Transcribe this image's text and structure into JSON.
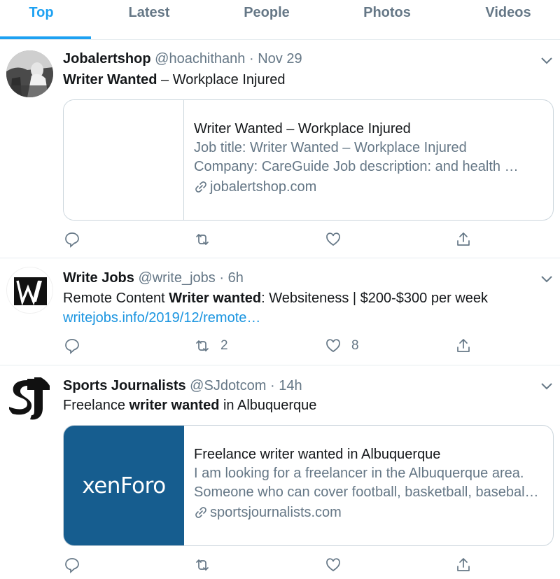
{
  "tabs": [
    {
      "label": "Top",
      "active": true
    },
    {
      "label": "Latest",
      "active": false
    },
    {
      "label": "People",
      "active": false
    },
    {
      "label": "Photos",
      "active": false
    },
    {
      "label": "Videos",
      "active": false
    }
  ],
  "tweets": [
    {
      "name": "Jobalertshop",
      "handle": "@hoachithanh",
      "separator": "·",
      "time": "Nov 29",
      "text_bold": "Writer Wanted",
      "text_rest": " – Workplace Injured",
      "card": {
        "title": "Writer Wanted – Workplace Injured",
        "desc1": "Job title: Writer Wanted – Workplace Injured",
        "desc2": "Company: CareGuide Job description: and health …",
        "domain": "jobalertshop.com"
      }
    },
    {
      "name": "Write Jobs",
      "handle": "@write_jobs",
      "separator": "·",
      "time": "6h",
      "text_pre": "Remote Content ",
      "text_bold": "Writer wanted",
      "text_rest": ": Websiteness | $200-$300 per week",
      "link": "writejobs.info/2019/12/remote…",
      "retweets": "2",
      "likes": "8"
    },
    {
      "name": "Sports Journalists",
      "handle": "@SJdotcom",
      "separator": "·",
      "time": "14h",
      "text_pre": "Freelance ",
      "text_bold": "writer wanted",
      "text_rest": " in Albuquerque",
      "card": {
        "thumb_logo": "xenForo",
        "title": "Freelance writer wanted in Albuquerque",
        "desc1": "I am looking for a freelancer in the Albuquerque area.",
        "desc2": "Someone who can cover football, basketball, basebal…",
        "domain": "sportsjournalists.com"
      }
    }
  ],
  "icons": {
    "reply": "reply-icon",
    "retweet": "retweet-icon",
    "like": "heart-icon",
    "share": "share-icon",
    "link": "link-icon",
    "more": "chevron-down-icon"
  },
  "colors": {
    "accent": "#1da1f2",
    "link": "#1b95e0",
    "secondary_text": "#657786",
    "border": "#ccd6dd",
    "xenforo_bg": "#165d8f"
  }
}
